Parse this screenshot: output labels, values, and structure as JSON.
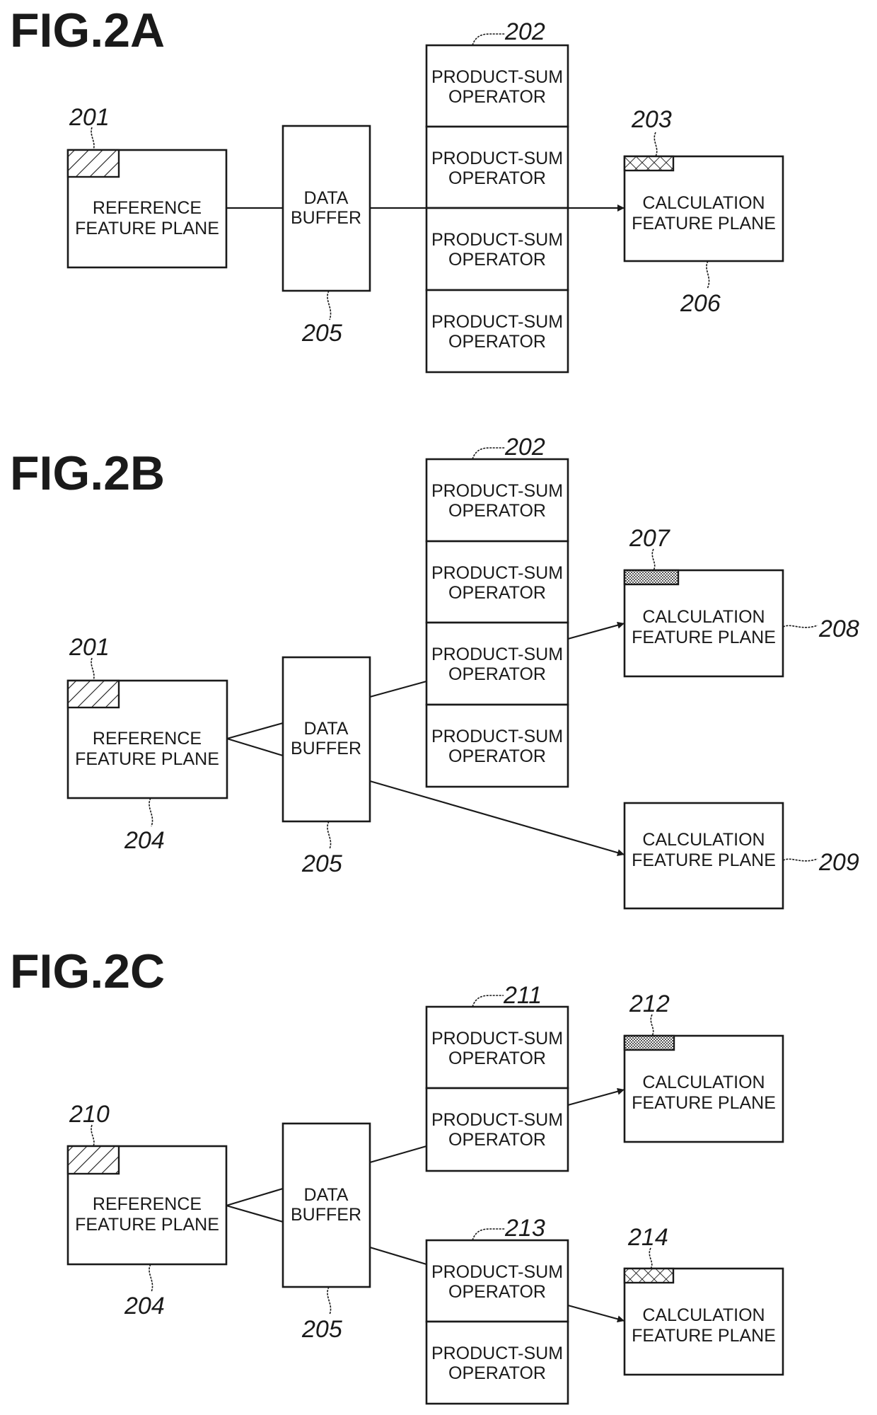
{
  "figures": {
    "a": {
      "title": "FIG.2A",
      "reference_plane": {
        "line1": "REFERENCE",
        "line2": "FEATURE PLANE",
        "tab_ref": "201",
        "tab_pattern": "diagonal-hatch"
      },
      "data_buffer": {
        "line1": "DATA",
        "line2": "BUFFER",
        "ref": "205"
      },
      "operator_group": {
        "ref": "202",
        "operators": [
          {
            "line1": "PRODUCT-SUM",
            "line2": "OPERATOR"
          },
          {
            "line1": "PRODUCT-SUM",
            "line2": "OPERATOR"
          },
          {
            "line1": "PRODUCT-SUM",
            "line2": "OPERATOR"
          },
          {
            "line1": "PRODUCT-SUM",
            "line2": "OPERATOR"
          }
        ]
      },
      "calc_plane": {
        "line1": "CALCULATION",
        "line2": "FEATURE PLANE",
        "tab_ref": "203",
        "tab_pattern": "cross-hatch",
        "ref": "206"
      }
    },
    "b": {
      "title": "FIG.2B",
      "reference_plane": {
        "line1": "REFERENCE",
        "line2": "FEATURE PLANE",
        "tab_ref": "201",
        "tab_pattern": "diagonal-hatch",
        "ref": "204"
      },
      "data_buffer": {
        "line1": "DATA",
        "line2": "BUFFER",
        "ref": "205"
      },
      "operator_group": {
        "ref": "202",
        "operators": [
          {
            "line1": "PRODUCT-SUM",
            "line2": "OPERATOR"
          },
          {
            "line1": "PRODUCT-SUM",
            "line2": "OPERATOR"
          },
          {
            "line1": "PRODUCT-SUM",
            "line2": "OPERATOR"
          },
          {
            "line1": "PRODUCT-SUM",
            "line2": "OPERATOR"
          }
        ]
      },
      "calc_plane_1": {
        "line1": "CALCULATION",
        "line2": "FEATURE PLANE",
        "tab_ref": "207",
        "tab_pattern": "dots",
        "ref": "208"
      },
      "calc_plane_2": {
        "line1": "CALCULATION",
        "line2": "FEATURE PLANE",
        "ref": "209"
      }
    },
    "c": {
      "title": "FIG.2C",
      "reference_plane": {
        "line1": "REFERENCE",
        "line2": "FEATURE PLANE",
        "tab_ref": "210",
        "tab_pattern": "diagonal-hatch",
        "ref": "204"
      },
      "data_buffer": {
        "line1": "DATA",
        "line2": "BUFFER",
        "ref": "205"
      },
      "operator_group_1": {
        "ref": "211",
        "operators": [
          {
            "line1": "PRODUCT-SUM",
            "line2": "OPERATOR"
          },
          {
            "line1": "PRODUCT-SUM",
            "line2": "OPERATOR"
          }
        ]
      },
      "operator_group_2": {
        "ref": "213",
        "operators": [
          {
            "line1": "PRODUCT-SUM",
            "line2": "OPERATOR"
          },
          {
            "line1": "PRODUCT-SUM",
            "line2": "OPERATOR"
          }
        ]
      },
      "calc_plane_1": {
        "line1": "CALCULATION",
        "line2": "FEATURE PLANE",
        "tab_ref": "212",
        "tab_pattern": "dots"
      },
      "calc_plane_2": {
        "line1": "CALCULATION",
        "line2": "FEATURE PLANE",
        "tab_ref": "214",
        "tab_pattern": "cross-hatch"
      }
    }
  }
}
